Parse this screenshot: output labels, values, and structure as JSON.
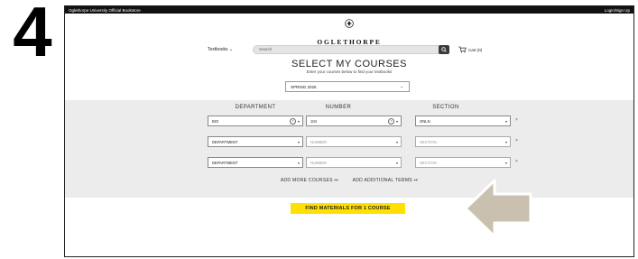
{
  "step": {
    "number": "4"
  },
  "topbar": {
    "site_title": "Oglethorpe University Official Bookstore",
    "login_label": "Login/Sign Up"
  },
  "logo": {
    "name": "OGLETHORPE",
    "subtitle": "UNIVERSITY"
  },
  "nav": {
    "textbooks_label": "Textbooks",
    "search_placeholder": "Search",
    "cart_label": "Cart (0)"
  },
  "heading": {
    "title": "SELECT MY COURSES",
    "subtitle": "Enter your courses below to find your textbooks"
  },
  "term": {
    "selected": "SPRING 2026"
  },
  "columns": {
    "department": "DEPARTMENT",
    "number": "NUMBER",
    "section": "SECTION"
  },
  "courses": [
    {
      "department": "BIO",
      "number": "104",
      "section": "ONLN"
    },
    {
      "department": "DEPARTMENT",
      "number": "NUMBER",
      "section": "SECTION"
    },
    {
      "department": "DEPARTMENT",
      "number": "NUMBER",
      "section": "SECTION"
    }
  ],
  "actions": {
    "add_more": "ADD MORE COURSES ↦",
    "add_terms": "ADD ADDITIONAL TERMS ↦",
    "find_button": "FIND MATERIALS FOR 1 COURSE"
  },
  "icons": {
    "crest": "crest-icon",
    "search": "search-icon",
    "cart": "cart-icon",
    "arrow": "pointer-arrow-icon"
  },
  "colors": {
    "topbar": "#111111",
    "find_button": "#ffe000",
    "band": "#ececec",
    "arrow": "#c9c0b0"
  }
}
